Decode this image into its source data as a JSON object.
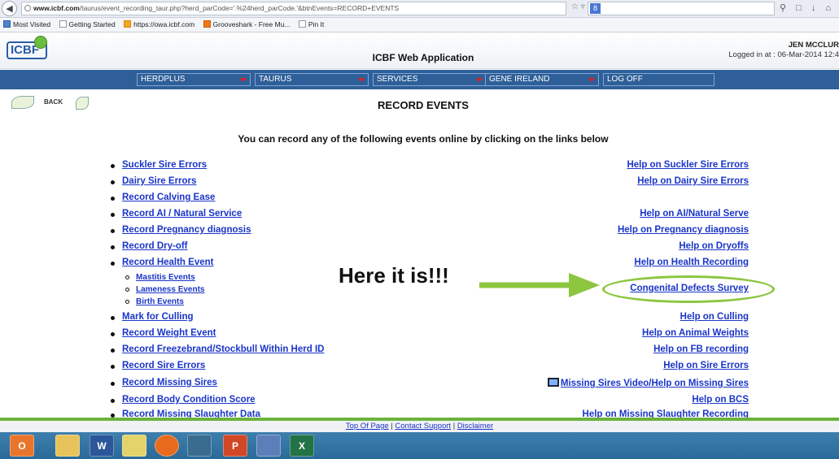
{
  "browser": {
    "url_domain": "www.icbf.com",
    "url_rest": "/taurus/event_recording_taur.php?herd_parCode='.%24herd_parCode.'&btnEvents=RECORD+EVENTS",
    "search_glyph": "8",
    "bookmarks": [
      "Most Visited",
      "Getting Started",
      "https://owa.icbf.com",
      "Grooveshark - Free Mu...",
      "Pin It"
    ]
  },
  "header": {
    "logo_text": "ICBF",
    "title": "ICBF Web Application",
    "user_name": "JEN MCCLUR",
    "logged_in": "Logged in at : 06-Mar-2014 12:4"
  },
  "nav": [
    "HERDPLUS",
    "TAURUS",
    "SERVICES",
    "GENE IRELAND",
    "LOG OFF"
  ],
  "page": {
    "back_label": "BACK",
    "title": "RECORD EVENTS",
    "intro": "You can record any of the following events online by clicking on the links below"
  },
  "events": [
    "Suckler Sire Errors",
    "Dairy Sire Errors",
    "Record Calving Ease",
    "Record AI / Natural Service",
    "Record Pregnancy diagnosis",
    "Record Dry-off",
    "Record Health Event",
    "Mark for Culling",
    "Record Weight Event",
    "Record Freezebrand/Stockbull Within Herd ID",
    "Record Sire Errors",
    "Record Missing Sires",
    "Record Body Condition Score",
    "Record Missing Slaughter Data"
  ],
  "health_sub_events": [
    "Mastitis Events",
    "Lameness Events",
    "Birth Events"
  ],
  "help_links": [
    "Help on Suckler Sire Errors",
    "Help on Dairy Sire Errors",
    "Help on AI/Natural Serve",
    "Help on Pregnancy diagnosis",
    "Help on Dryoffs",
    "Help on Health Recording",
    "Congenital Defects Survey",
    "Help on Culling",
    "Help on Animal Weights",
    "Help on FB recording",
    "Help on Sire Errors",
    "Missing Sires Video/Help on Missing Sires",
    "Help on BCS",
    "Help on Missing Slaughter Recording"
  ],
  "annotation": {
    "text": "Here it is!!!",
    "highlight_color": "#8cc63f"
  },
  "footer": {
    "top_of_page": "Top Of Page",
    "contact_support": "Contact Support",
    "disclaimer": "Disclaimer",
    "separator": "|"
  },
  "taskbar_apps": [
    "outlook-app",
    "file-explorer-app",
    "word-app",
    "app-4",
    "firefox-app",
    "app-6",
    "powerpoint-app",
    "app-8",
    "excel-app"
  ],
  "colors": {
    "nav_bar": "#2e5f98",
    "link": "#1a35c8",
    "footer_accent": "#6cb33e",
    "taskbar": "#2f6f9f"
  }
}
